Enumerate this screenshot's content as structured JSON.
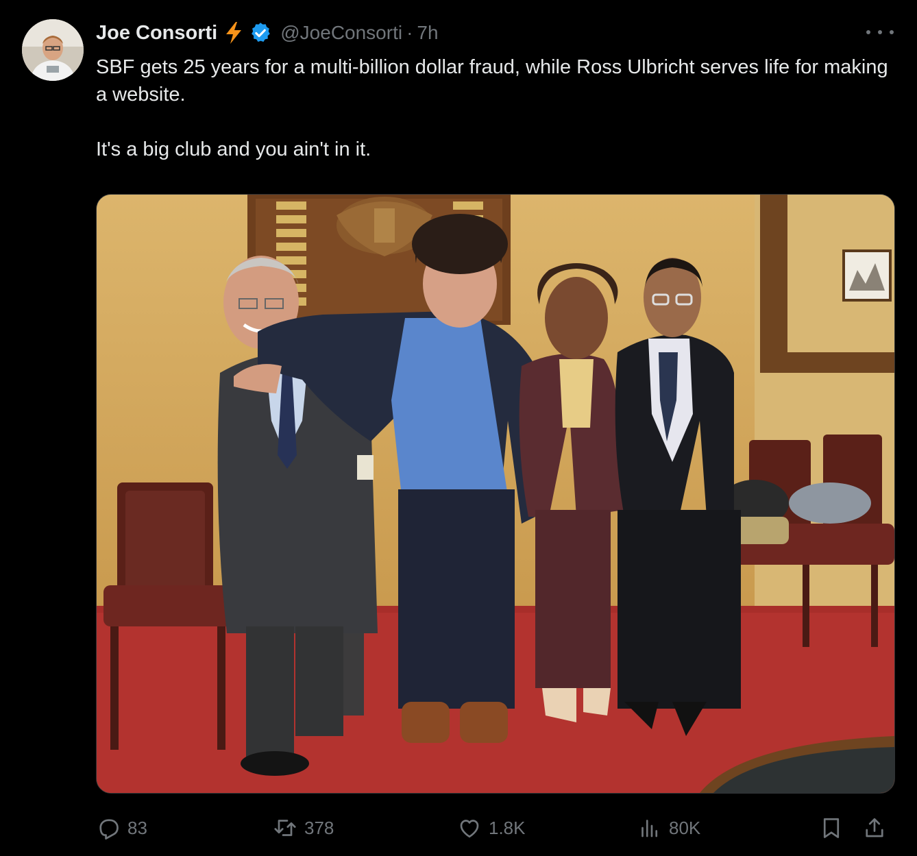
{
  "tweet": {
    "author_name": "Joe Consorti",
    "handle": "@JoeConsorti",
    "separator": "·",
    "time": "7h",
    "text_line1": "SBF gets 25 years for a multi-billion dollar fraud, while Ross Ulbricht serves life for making a website.",
    "text_line2": "It's a big club and you ain't in it."
  },
  "icons": {
    "author_badge": "lightning-bolt-icon",
    "verified": "verified-badge-icon",
    "more": "more-icon",
    "reply": "reply-icon",
    "retweet": "retweet-icon",
    "like": "like-icon",
    "views": "views-icon",
    "bookmark": "bookmark-icon",
    "share": "share-icon"
  },
  "actions": {
    "replies": "83",
    "retweets": "378",
    "likes": "1.8K",
    "views": "80K"
  },
  "colors": {
    "background": "#000000",
    "text": "#e7e9ea",
    "muted": "#71767b",
    "verified": "#1d9bf0",
    "bolt": "#f7931a"
  }
}
